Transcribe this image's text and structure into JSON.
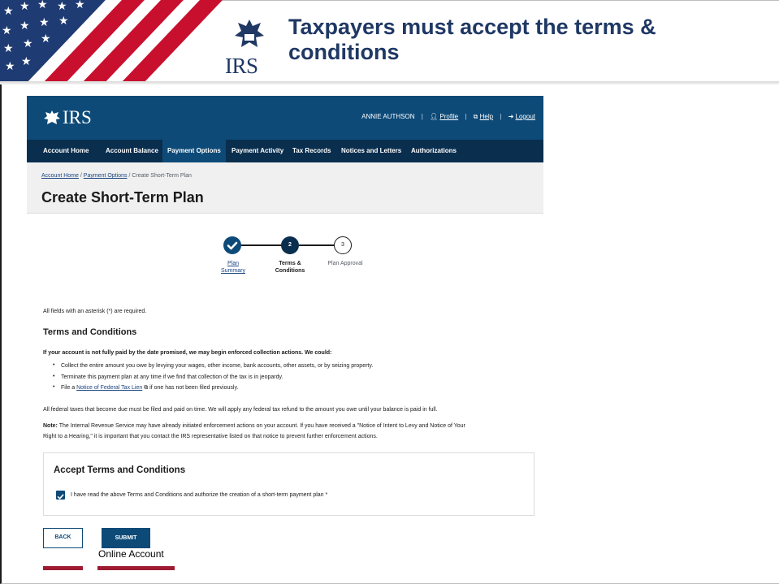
{
  "slide": {
    "title": "Taxpayers must accept the terms & conditions",
    "logo_word": "IRS",
    "caption": "Online Account",
    "accent_color": "#9e1b32",
    "title_color": "#1f3864"
  },
  "app": {
    "logo_word": "IRS",
    "user_name": "ANNIE AUTHSON",
    "links": {
      "profile": "Profile",
      "help": "Help",
      "logout": "Logout"
    },
    "nav": [
      "Account Home",
      "Account Balance",
      "Payment Options",
      "Payment Activity",
      "Tax Records",
      "Notices and Letters",
      "Authorizations"
    ],
    "active_nav": "Payment Options",
    "breadcrumb": {
      "home": "Account Home",
      "payment_options": "Payment Options",
      "current": "Create Short-Term Plan",
      "separator": "/"
    },
    "page_title": "Create Short-Term Plan",
    "steps": [
      {
        "number": "1",
        "label_line1": "Plan",
        "label_line2": "Summary",
        "state": "complete"
      },
      {
        "number": "2",
        "label_line1": "Terms &",
        "label_line2": "Conditions",
        "state": "current"
      },
      {
        "number": "3",
        "label_line1": "Plan Approval",
        "label_line2": "",
        "state": "upcoming"
      }
    ],
    "required_note": "All fields with an asterisk (*) are required.",
    "terms_heading": "Terms and Conditions",
    "warning": "If your account is not fully paid by the date promised, we may begin enforced collection actions. We could:",
    "bullets": {
      "b1": "Collect the entire amount you owe by levying your wages, other income, bank accounts, other assets, or by seizing property.",
      "b2": "Terminate this payment plan at any time if we find that collection of the tax is in jeopardy.",
      "b3_pre": "File a ",
      "b3_link": "Notice of Federal Tax Lien",
      "b3_post": " if one has not been filed previously."
    },
    "federal_taxes": "All federal taxes that become due must be filed and paid on time. We will apply any federal tax refund to the amount you owe until your balance is paid in full.",
    "note_label": "Note:",
    "note_line1": " The Internal Revenue Service may have already initiated enforcement actions on your account. If you have received a \"Notice of Intent to Levy and Notice of Your",
    "note_line2": "Right to a Hearing,\" it is important that you contact the IRS representative listed on that notice to prevent further enforcement actions.",
    "accept_heading": "Accept Terms and Conditions",
    "accept_label": "I have read the above Terms and Conditions and authorize the creation of a short-term payment plan *",
    "accept_checked": true,
    "back_label": "BACK",
    "submit_label": "SUBMIT",
    "primary_color": "#0d4a78",
    "nav_color": "#0a2e4e"
  }
}
